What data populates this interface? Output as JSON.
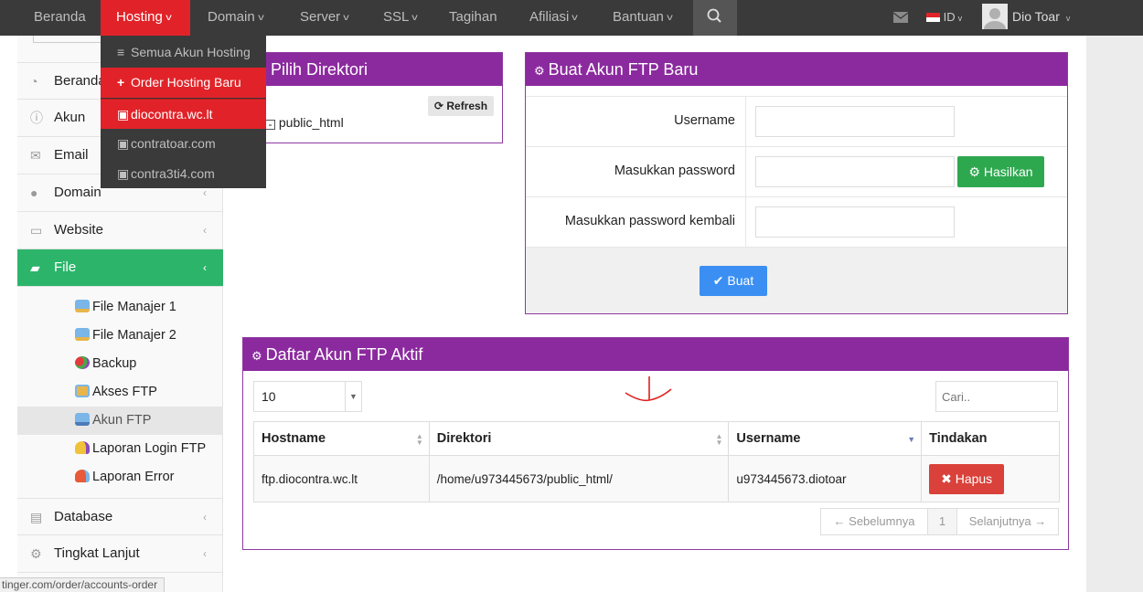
{
  "topnav": {
    "items": [
      {
        "label": "Beranda"
      },
      {
        "label": "Hosting"
      },
      {
        "label": "Domain"
      },
      {
        "label": "Server"
      },
      {
        "label": "SSL"
      },
      {
        "label": "Tagihan"
      },
      {
        "label": "Afiliasi"
      },
      {
        "label": "Bantuan"
      }
    ],
    "language": "ID",
    "user_name": "Dio Toar"
  },
  "hosting_dropdown": {
    "items": [
      {
        "label": "Semua Akun Hosting",
        "icon": "list-icon"
      },
      {
        "label": "Order Hosting Baru",
        "icon": "plus-icon"
      },
      {
        "label": "diocontra.wc.lt",
        "icon": "hosting-icon"
      },
      {
        "label": "contratoar.com",
        "icon": "hosting-icon"
      },
      {
        "label": "contra3ti4.com",
        "icon": "hosting-icon"
      }
    ]
  },
  "sidebar": {
    "items": [
      {
        "label": "Beranda",
        "icon": "dashboard-icon"
      },
      {
        "label": "Akun",
        "icon": "info-icon"
      },
      {
        "label": "Email",
        "icon": "envelope-icon"
      },
      {
        "label": "Domain",
        "icon": "globe-icon"
      },
      {
        "label": "Website",
        "icon": "monitor-icon"
      },
      {
        "label": "File",
        "icon": "folder-open-icon"
      },
      {
        "label": "Database",
        "icon": "database-icon"
      },
      {
        "label": "Tingkat Lanjut",
        "icon": "gears-icon"
      }
    ],
    "file_sub": [
      {
        "label": "File Manajer 1"
      },
      {
        "label": "File Manajer 2"
      },
      {
        "label": "Backup"
      },
      {
        "label": "Akses FTP"
      },
      {
        "label": "Akun FTP"
      },
      {
        "label": "Laporan Login FTP"
      },
      {
        "label": "Laporan Error"
      }
    ]
  },
  "directory_panel": {
    "title": "Pilih Direktori",
    "refresh_label": "Refresh",
    "tree_root": "public_html"
  },
  "create_panel": {
    "title": "Buat Akun FTP Baru",
    "username_label": "Username",
    "password_label": "Masukkan password",
    "password_confirm_label": "Masukkan password kembali",
    "generate_label": "Hasilkan",
    "submit_label": "Buat"
  },
  "list_panel": {
    "title": "Daftar Akun FTP Aktif",
    "page_size": "10",
    "search_placeholder": "Cari..",
    "columns": [
      "Hostname",
      "Direktori",
      "Username",
      "Tindakan"
    ],
    "rows": [
      {
        "hostname": "ftp.diocontra.wc.lt",
        "directory": "/home/u973445673/public_html/",
        "username": "u973445673.diotoar",
        "action": "Hapus"
      }
    ],
    "prev_label": "← Sebelumnya",
    "page_number": "1",
    "next_label": "Selanjutnya →"
  },
  "status_url": "tinger.com/order/accounts-order",
  "colors": {
    "accent": "#8b2a9e",
    "danger": "#e12329",
    "success": "#2cb56a",
    "primary": "#3b8ff2"
  }
}
